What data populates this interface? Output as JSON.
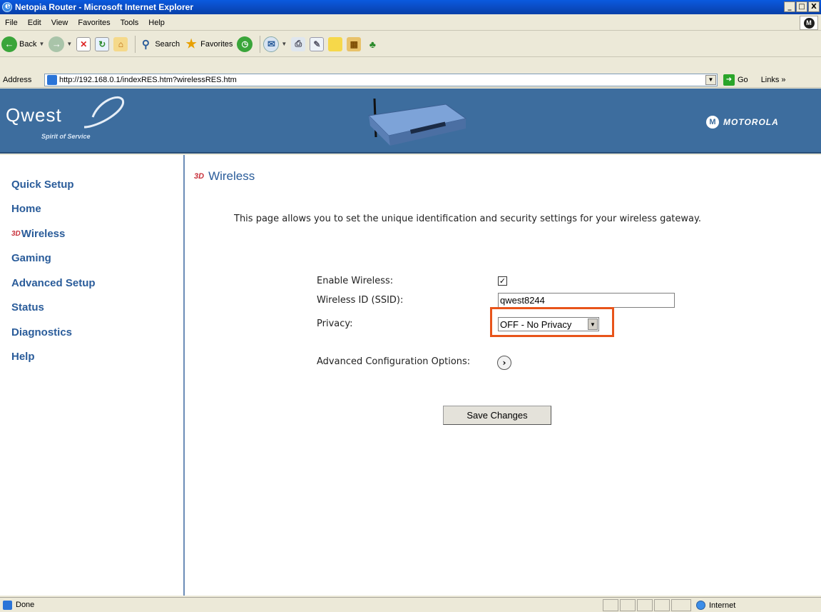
{
  "window": {
    "title": "Netopia Router - Microsoft Internet Explorer",
    "buttons": [
      "_",
      "□",
      "X"
    ]
  },
  "menu": {
    "items": [
      "File",
      "Edit",
      "View",
      "Favorites",
      "Tools",
      "Help"
    ]
  },
  "toolbar": {
    "back_label": "Back",
    "search_label": "Search",
    "favorites_label": "Favorites"
  },
  "address": {
    "label": "Address",
    "url": "http://192.168.0.1/indexRES.htm?wirelessRES.htm",
    "go_label": "Go",
    "links_label": "Links »"
  },
  "header": {
    "brand": "Qwest",
    "tagline": "Spirit of Service",
    "partner": "MOTOROLA",
    "colors": {
      "band": "#3d6d9e",
      "nav_text": "#2a5c9a",
      "highlight": "#e8541a"
    }
  },
  "sidebar": {
    "items": [
      {
        "label": "Quick Setup",
        "prefix": ""
      },
      {
        "label": "Home",
        "prefix": ""
      },
      {
        "label": "Wireless",
        "prefix": "3D"
      },
      {
        "label": "Gaming",
        "prefix": ""
      },
      {
        "label": "Advanced Setup",
        "prefix": ""
      },
      {
        "label": "Status",
        "prefix": ""
      },
      {
        "label": "Diagnostics",
        "prefix": ""
      },
      {
        "label": "Help",
        "prefix": ""
      }
    ]
  },
  "main": {
    "heading_prefix": "3D",
    "heading": "Wireless",
    "intro": "This page allows you to set the unique identification and security settings for your wireless gateway.",
    "form": {
      "enable_label": "Enable Wireless:",
      "enable_checked": true,
      "enable_mark": "✓",
      "ssid_label": "Wireless ID (SSID):",
      "ssid_value": "qwest8244",
      "privacy_label": "Privacy:",
      "privacy_value": "OFF - No Privacy",
      "advanced_label": "Advanced Configuration Options:",
      "advanced_icon": "›"
    },
    "save_label": "Save Changes"
  },
  "status": {
    "text": "Done",
    "zone": "Internet"
  }
}
